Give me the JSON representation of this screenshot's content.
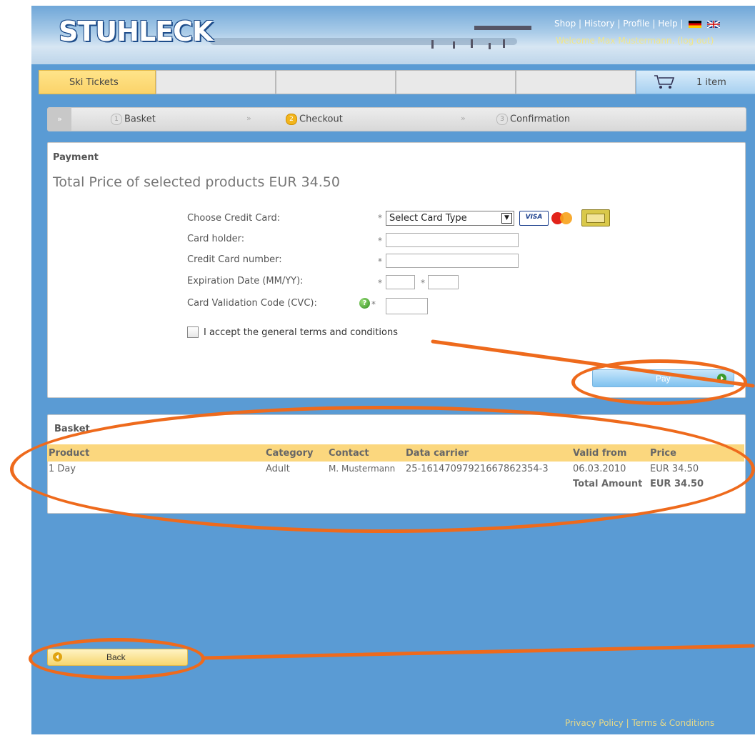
{
  "header": {
    "logo": "STUHLECK",
    "nav": [
      "Shop",
      "History",
      "Profile",
      "Help"
    ],
    "separator": " | ",
    "welcome": "Welcome Max Mustermann. (log out)"
  },
  "tabs": {
    "active_label": "Ski Tickets",
    "cart_label": "1 item"
  },
  "steps": [
    {
      "num": "1",
      "label": "Basket"
    },
    {
      "num": "2",
      "label": "Checkout"
    },
    {
      "num": "3",
      "label": "Confirmation"
    }
  ],
  "payment": {
    "heading": "Payment",
    "total": "Total Price of selected products EUR 34.50",
    "choose_card_label": "Choose Credit Card:",
    "card_select_value": "Select Card Type",
    "card_holder_label": "Card holder:",
    "card_number_label": "Credit Card number:",
    "expiry_label": "Expiration Date (MM/YY):",
    "cvc_label": "Card Validation Code (CVC):",
    "required_mark": "*",
    "terms_label": "I accept the general terms and conditions",
    "pay_button": "Pay",
    "card_icons": [
      "visa-card-icon",
      "mastercard-icon",
      "ec-card-icon"
    ],
    "visa_text": "VISA"
  },
  "basket": {
    "heading": "Basket",
    "columns": [
      "Product",
      "Category",
      "Contact",
      "Data carrier",
      "Valid from",
      "Price"
    ],
    "rows": [
      {
        "product": "1 Day",
        "category": "Adult",
        "contact": "M. Mustermann",
        "carrier": "25-16147097921667862354-3",
        "valid_from": "06.03.2010",
        "price": "EUR 34.50"
      }
    ],
    "total_label": "Total Amount",
    "total_value": "EUR 34.50"
  },
  "back_button": "Back",
  "footer": {
    "privacy": "Privacy Policy",
    "separator": " | ",
    "terms": "Terms & Conditions"
  },
  "colors": {
    "annotation": "#ee6a1c",
    "frame": "#5a9bd4",
    "accent": "#fbd77e"
  }
}
